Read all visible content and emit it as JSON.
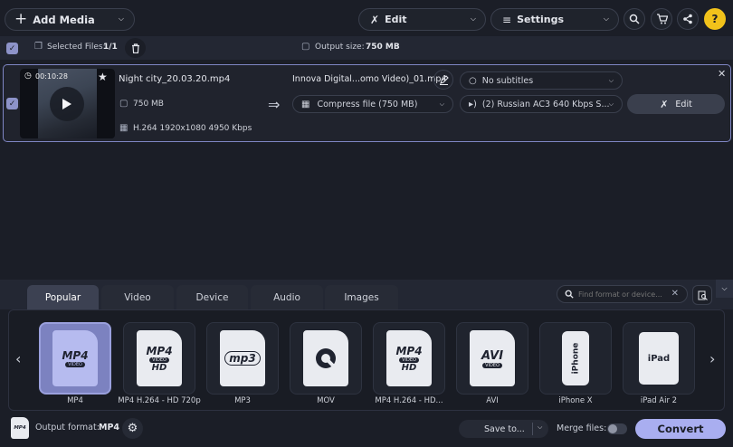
{
  "toolbar": {
    "add_media": "Add Media",
    "edit": "Edit",
    "settings": "Settings"
  },
  "subheader": {
    "selected_label": "Selected Files:",
    "selected_count": "1/1",
    "output_size_label": "Output size:",
    "output_size_value": "750 MB"
  },
  "file": {
    "duration": "00:10:28",
    "name": "Night city_20.03.20.mp4",
    "size": "750 MB",
    "codec": "H.264 1920x1080 4950 Kbps",
    "output_name": "Innova Digital...omo Video)_01.mp4",
    "subtitles": "No subtitles",
    "compress": "Compress file (750 MB)",
    "audio": "(2) Russian AC3 640 Kbps S...",
    "edit": "Edit"
  },
  "tabs": [
    "Popular",
    "Video",
    "Device",
    "Audio",
    "Images"
  ],
  "search": {
    "placeholder": "Find format or device..."
  },
  "formats": [
    {
      "label": "MP4",
      "icon": "mp4-doc-icon"
    },
    {
      "label": "MP4 H.264 - HD 720p",
      "icon": "mp4-hd-doc-icon"
    },
    {
      "label": "MP3",
      "icon": "mp3-doc-icon"
    },
    {
      "label": "MOV",
      "icon": "quicktime-doc-icon"
    },
    {
      "label": "MP4 H.264 - HD...",
      "icon": "mp4-hd-doc-icon"
    },
    {
      "label": "AVI",
      "icon": "avi-doc-icon"
    },
    {
      "label": "iPhone X",
      "icon": "iphone-icon"
    },
    {
      "label": "iPad Air 2",
      "icon": "ipad-icon"
    }
  ],
  "format_text": {
    "mp4": "MP4",
    "video": "VIDEO",
    "hd": "HD",
    "mp3": "mp3",
    "avi": "AVI",
    "iphone": "iPhone",
    "ipad": "iPad"
  },
  "bottom": {
    "output_format_label": "Output format:",
    "output_format_value": "MP4",
    "save_to": "Save to...",
    "merge_files": "Merge files:",
    "convert": "Convert"
  },
  "colors": {
    "accent": "#8e95cf",
    "selected_border": "#7f86c4",
    "background": "#1b1e27",
    "convert_bg": "#a9aef0"
  }
}
